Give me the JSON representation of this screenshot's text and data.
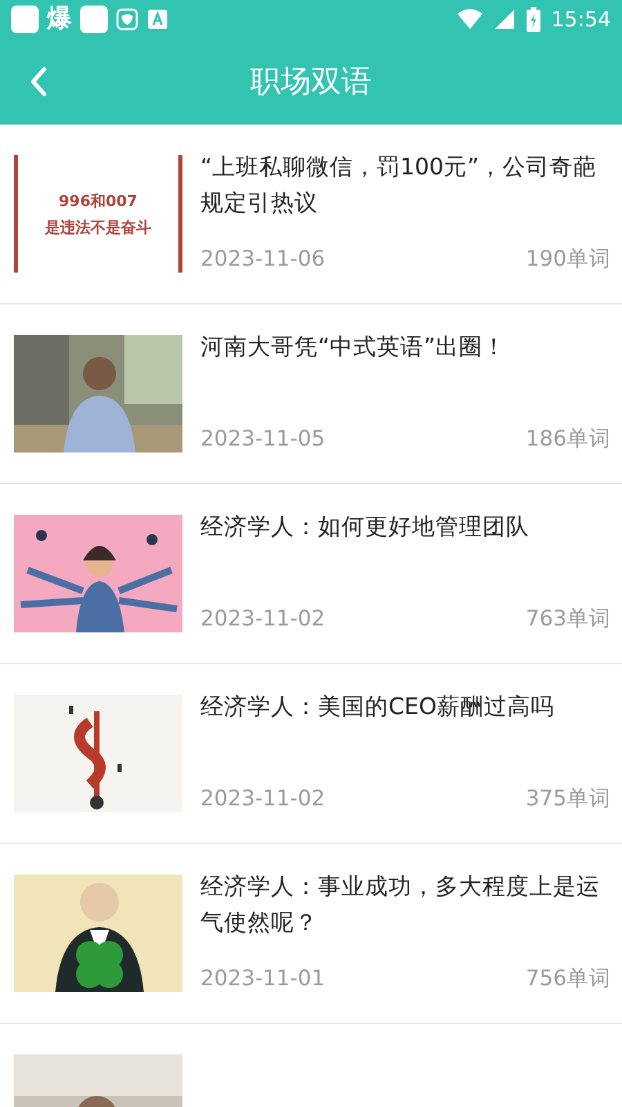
{
  "status_bar": {
    "app_glyph": "爆",
    "time": "15:54"
  },
  "header": {
    "title": "职场双语"
  },
  "articles": [
    {
      "title": "“上班私聊微信，罚100元”，公司奇葩规定引热议",
      "date": "2023-11-06",
      "words": "190单词",
      "thumb": {
        "kind": "text_card",
        "lines": [
          "996和007",
          "是违法不是奋斗"
        ]
      }
    },
    {
      "title": "河南大哥凭“中式英语”出圈！",
      "date": "2023-11-05",
      "words": "186单词",
      "thumb": {
        "kind": "picture"
      }
    },
    {
      "title": "经济学人：如何更好地管理团队",
      "date": "2023-11-02",
      "words": "763单词",
      "thumb": {
        "kind": "picture"
      }
    },
    {
      "title": "经济学人：美国的CEO薪酬过高吗",
      "date": "2023-11-02",
      "words": "375单词",
      "thumb": {
        "kind": "picture"
      }
    },
    {
      "title": "经济学人：事业成功，多大程度上是运气使然呢？",
      "date": "2023-11-01",
      "words": "756单词",
      "thumb": {
        "kind": "picture"
      }
    },
    {
      "thumb": {
        "kind": "picture"
      }
    }
  ]
}
